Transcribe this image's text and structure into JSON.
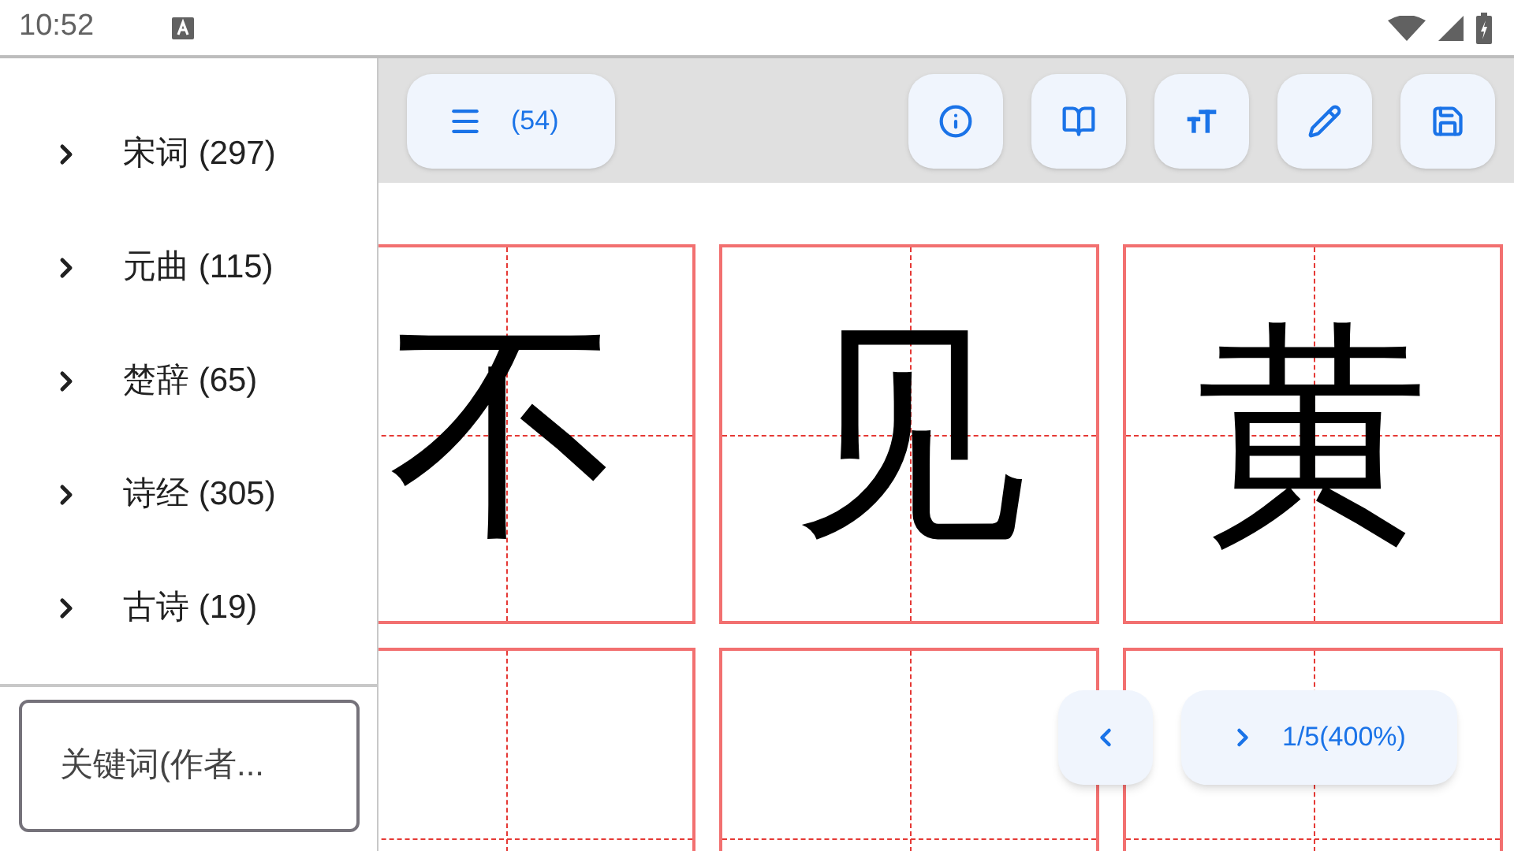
{
  "status_bar": {
    "time": "10:52"
  },
  "sidebar": {
    "items": [
      {
        "label": "宋词 (297)"
      },
      {
        "label": "元曲 (115)"
      },
      {
        "label": "楚辞 (65)"
      },
      {
        "label": "诗经 (305)"
      },
      {
        "label": "古诗 (19)"
      }
    ],
    "search": {
      "placeholder": "关键词(作者..."
    }
  },
  "toolbar": {
    "menu_button": {
      "label": "(54)"
    },
    "actions": [
      {
        "kind": "info"
      },
      {
        "kind": "book"
      },
      {
        "kind": "text-size"
      },
      {
        "kind": "edit"
      },
      {
        "kind": "save"
      }
    ]
  },
  "grid": {
    "cells": [
      "不",
      "见",
      "黄"
    ]
  },
  "pager": {
    "page": "1/5(400%)"
  }
}
